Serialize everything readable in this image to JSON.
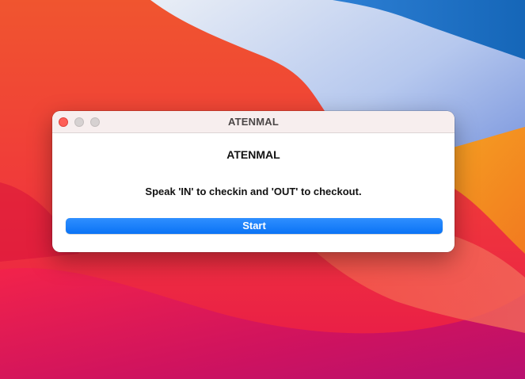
{
  "window": {
    "title": "ATENMAL"
  },
  "app": {
    "heading": "ATENMAL",
    "instructions": "Speak 'IN' to checkin and 'OUT' to checkout.",
    "start_label": "Start"
  },
  "colors": {
    "accent": "#0a73f5",
    "close_button": "#fe5f57",
    "titlebar": "#f7eeee"
  }
}
